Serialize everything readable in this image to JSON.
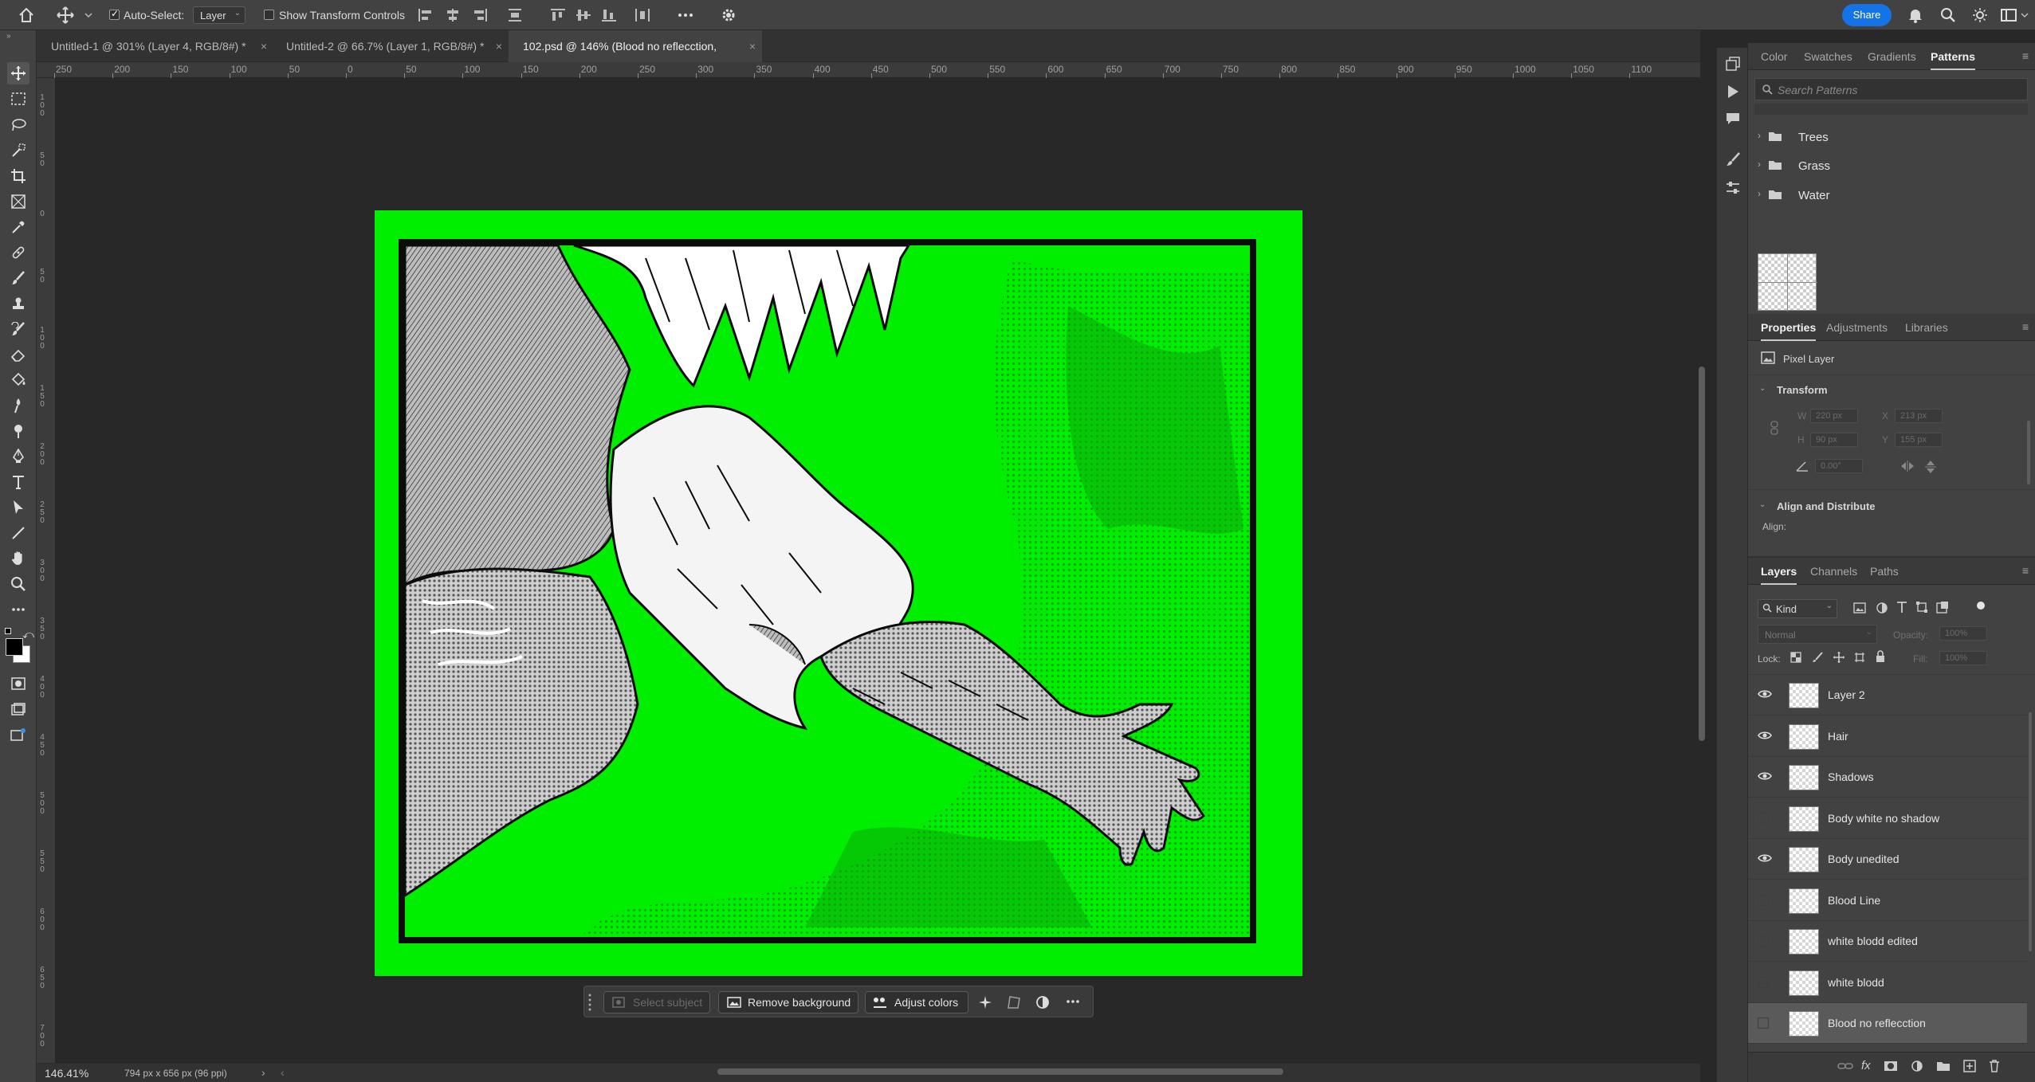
{
  "options_bar": {
    "auto_select_label": "Auto-Select:",
    "auto_select_checked": true,
    "auto_select_target": "Layer",
    "show_transform_label": "Show Transform Controls",
    "show_transform_checked": false,
    "share_label": "Share"
  },
  "tabs": [
    {
      "label": "Untitled-1 @ 301% (Layer 4, RGB/8#) *",
      "active": false
    },
    {
      "label": "Untitled-2 @ 66.7% (Layer 1, RGB/8#) *",
      "active": false
    },
    {
      "label": "102.psd @ 146% (Blood no reflecction, RGB/8#)",
      "active": true
    }
  ],
  "ruler": {
    "h_labels": [
      "250",
      "200",
      "150",
      "100",
      "50",
      "0",
      "50",
      "100",
      "150",
      "200",
      "250",
      "300",
      "350",
      "400",
      "450",
      "500",
      "550",
      "600",
      "650",
      "700",
      "750",
      "800",
      "850",
      "900",
      "950",
      "1000",
      "1050",
      "1100"
    ],
    "v_labels": [
      "1 0 0",
      "5 0",
      "0",
      "5 0",
      "1 0 0",
      "1 5 0",
      "2 0 0",
      "2 5 0",
      "3 0 0",
      "3 5 0",
      "4 0 0",
      "4 5 0",
      "5 0 0",
      "5 5 0",
      "6 0 0",
      "6 5 0",
      "7 0 0"
    ]
  },
  "context_bar": {
    "select_subject": "Select subject",
    "remove_background": "Remove background",
    "adjust_colors": "Adjust colors"
  },
  "status": {
    "zoom": "146.41%",
    "doc_info": "794 px x 656 px (96 ppi)"
  },
  "patterns_panel": {
    "tabs": [
      "Color",
      "Swatches",
      "Gradients",
      "Patterns"
    ],
    "active_tab": "Patterns",
    "search_placeholder": "Search Patterns",
    "folders": [
      "Trees",
      "Grass",
      "Water"
    ]
  },
  "properties_panel": {
    "tabs": [
      "Properties",
      "Adjustments",
      "Libraries"
    ],
    "active_tab": "Properties",
    "layer_kind": "Pixel Layer",
    "transform_title": "Transform",
    "w_label": "W",
    "w_value": "220 px",
    "h_label": "H",
    "h_value": "90 px",
    "x_label": "X",
    "x_value": "213 px",
    "y_label": "Y",
    "y_value": "155 px",
    "angle_value": "0.00°",
    "align_title": "Align and Distribute",
    "align_label": "Align:"
  },
  "layers_panel": {
    "tabs": [
      "Layers",
      "Channels",
      "Paths"
    ],
    "active_tab": "Layers",
    "filter_label": "Kind",
    "blend_mode": "Normal",
    "opacity_label": "Opacity:",
    "opacity_value": "100%",
    "lock_label": "Lock:",
    "fill_label": "Fill:",
    "fill_value": "100%",
    "layers": [
      {
        "name": "Layer 2",
        "visible": true,
        "selected": false
      },
      {
        "name": "Hair",
        "visible": true,
        "selected": false
      },
      {
        "name": "Shadows",
        "visible": true,
        "selected": false
      },
      {
        "name": "Body white no shadow",
        "visible": false,
        "selected": false
      },
      {
        "name": "Body unedited",
        "visible": true,
        "selected": false
      },
      {
        "name": "Blood Line",
        "visible": false,
        "selected": false
      },
      {
        "name": "white blodd edited",
        "visible": false,
        "selected": false
      },
      {
        "name": "white blodd",
        "visible": false,
        "selected": false
      },
      {
        "name": "Blood no reflecction",
        "visible": false,
        "selected": true
      }
    ]
  },
  "colors": {
    "canvas_green": "#00ee00",
    "accent_blue": "#1473e6"
  }
}
